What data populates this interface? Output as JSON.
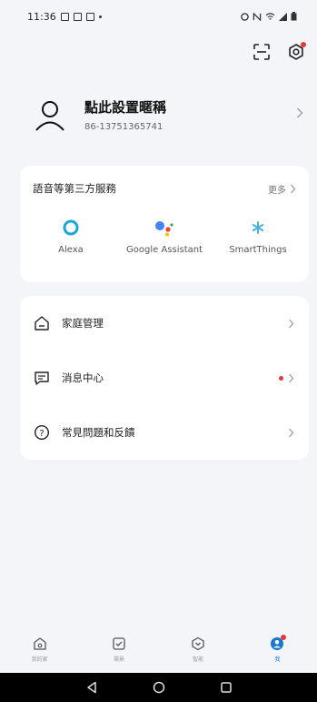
{
  "status_bar": {
    "time": "11:36"
  },
  "profile": {
    "name": "點此設置暱稱",
    "phone": "86-13751365741"
  },
  "services": {
    "title": "語音等第三方服務",
    "more_label": "更多",
    "items": [
      {
        "name": "Alexa",
        "icon": "alexa-icon"
      },
      {
        "name": "Google Assistant",
        "icon": "google-assistant-icon"
      },
      {
        "name": "SmartThings",
        "icon": "smartthings-icon"
      }
    ]
  },
  "menu": {
    "items": [
      {
        "label": "家庭管理",
        "icon": "home-icon"
      },
      {
        "label": "消息中心",
        "icon": "message-icon"
      },
      {
        "label": "常見問題和反饋",
        "icon": "help-icon"
      }
    ]
  },
  "bottom_nav": {
    "tabs": [
      {
        "label": "我的家",
        "icon": "home-tab-icon"
      },
      {
        "label": "場景",
        "icon": "scene-tab-icon"
      },
      {
        "label": "智能",
        "icon": "smart-tab-icon"
      },
      {
        "label": "我",
        "icon": "me-tab-icon",
        "active": true
      }
    ]
  },
  "colors": {
    "accent": "#1976d2",
    "alexa": "#1ba8d8",
    "badge": "#e53935",
    "background": "#f4f5f9"
  }
}
